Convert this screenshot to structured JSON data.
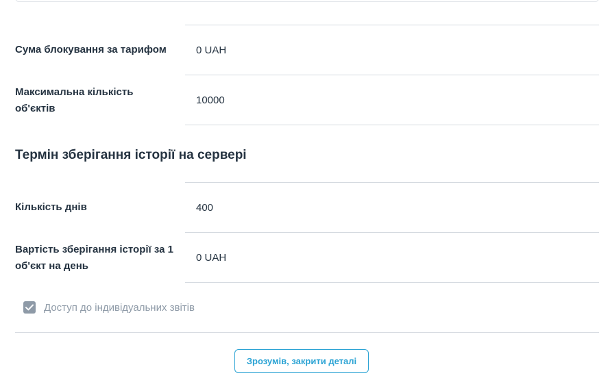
{
  "tariff_details": {
    "blocking_amount_label": "Сума блокування за тарифом",
    "blocking_amount_value": "0 UAH",
    "max_objects_label": "Максимальна кількість об'єктів",
    "max_objects_value": "10000"
  },
  "history_storage": {
    "title": "Термін зберігання історії на сервері",
    "days_label": "Кількість днів",
    "days_value": "400",
    "cost_label": "Вартість зберігання історії за 1 об'єкт на день",
    "cost_value": "0 UAH"
  },
  "reports_access": {
    "label": "Доступ до індивідуальних звітів",
    "checked": true,
    "icon": "check-icon"
  },
  "actions": {
    "close_label": "Зрозумів, закрити деталі"
  },
  "colors": {
    "accent": "#2ba3d4",
    "text": "#253341",
    "muted": "#8e9aa7",
    "divider": "#d4d9df"
  }
}
